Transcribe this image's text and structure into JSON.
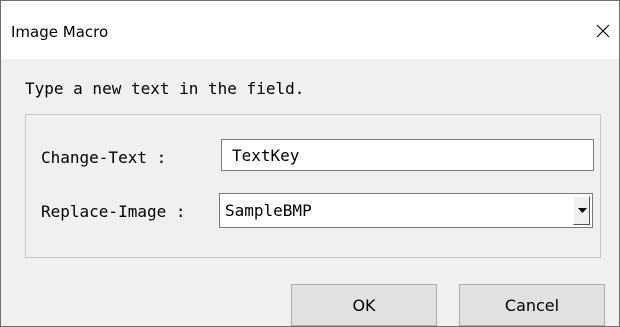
{
  "window": {
    "title": "Image Macro",
    "close_icon": "close-icon"
  },
  "dialog": {
    "instruction": "Type a new text in the field.",
    "change_text": {
      "label": "Change-Text :",
      "value": "TextKey"
    },
    "replace_image": {
      "label": "Replace-Image :",
      "selected": "SampleBMP",
      "arrow_icon": "dropdown-arrow-icon"
    }
  },
  "buttons": {
    "ok": "OK",
    "cancel": "Cancel"
  },
  "colors": {
    "title_bar": "#ffffff",
    "client_background": "#f0f0f0",
    "button_face": "#e1e1e1",
    "border": "#7a7a7a"
  }
}
